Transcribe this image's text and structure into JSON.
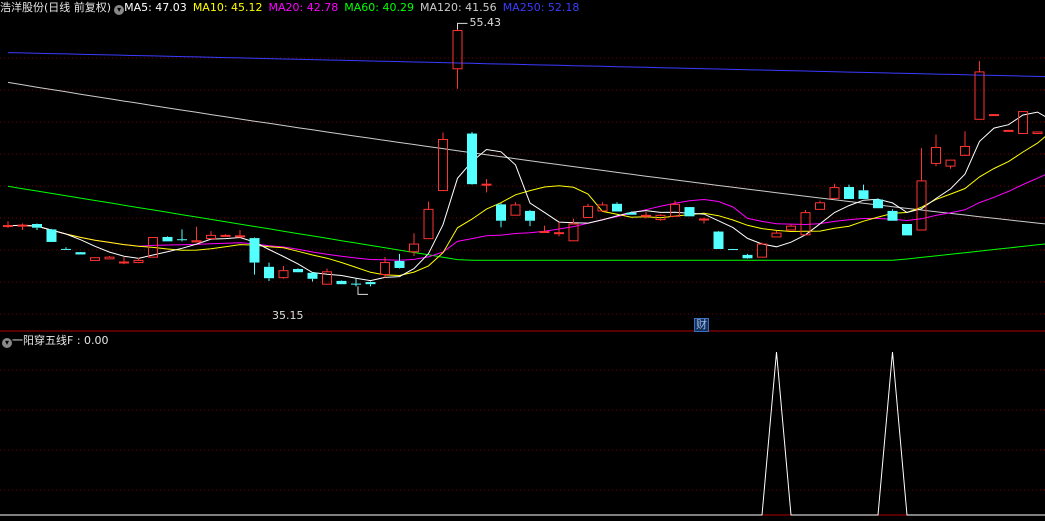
{
  "header": {
    "stock_title": "浩洋股份(日线 前复权)",
    "indicators": [
      {
        "label": "MA5: 47.03",
        "color": "#ffffff"
      },
      {
        "label": "MA10: 45.12",
        "color": "#ffff00"
      },
      {
        "label": "MA20: 42.78",
        "color": "#ff00ff"
      },
      {
        "label": "MA60: 40.29",
        "color": "#00ff00"
      },
      {
        "label": "MA120: 41.56",
        "color": "#cccccc"
      },
      {
        "label": "MA250: 52.18",
        "color": "#3b3bff"
      }
    ]
  },
  "annotations": {
    "high_label": "55.43",
    "low_label": "35.15",
    "event_marker": "财"
  },
  "lower_panel": {
    "title": "一阳穿五线F : 0.00"
  },
  "colors": {
    "up_candle": "#ff3232",
    "down_candle": "#54ffff",
    "grid": "#7a0000",
    "panel_border": "#b00000"
  },
  "chart_data": [
    {
      "type": "candlestick",
      "name": "price",
      "ylim": [
        34.3,
        56.3
      ],
      "candles": [
        [
          41.61,
          41.64,
          41.94,
          41.48
        ],
        [
          41.64,
          41.67,
          41.79,
          41.33
        ],
        [
          41.75,
          41.49,
          41.79,
          41.33
        ],
        [
          41.37,
          40.49,
          41.41,
          40.49
        ],
        [
          40.0,
          39.96,
          40.12,
          39.96
        ],
        [
          39.77,
          39.61,
          39.73,
          39.61
        ],
        [
          39.19,
          39.38,
          39.42,
          39.15
        ],
        [
          39.3,
          39.42,
          39.5,
          39.27
        ],
        [
          39.08,
          39.08,
          39.46,
          38.93
        ],
        [
          39.04,
          39.19,
          39.38,
          39.0
        ],
        [
          39.42,
          40.8,
          40.8,
          39.42
        ],
        [
          40.84,
          40.53,
          40.88,
          40.53
        ],
        [
          40.68,
          40.61,
          41.37,
          40.53
        ],
        [
          40.49,
          40.57,
          41.56,
          40.53
        ],
        [
          40.72,
          40.95,
          41.25,
          40.72
        ],
        [
          40.88,
          40.95,
          41.03,
          40.84
        ],
        [
          40.88,
          40.92,
          41.33,
          40.8
        ],
        [
          40.76,
          39.04,
          40.8,
          38.2
        ],
        [
          38.74,
          37.94,
          39.04,
          37.74
        ],
        [
          37.98,
          38.47,
          38.81,
          37.9
        ],
        [
          38.59,
          38.36,
          38.63,
          38.36
        ],
        [
          38.32,
          37.9,
          38.36,
          37.71
        ],
        [
          37.52,
          38.39,
          38.62,
          37.52
        ],
        [
          37.75,
          37.52,
          37.79,
          37.52
        ],
        [
          37.56,
          37.52,
          37.9,
          37.37
        ],
        [
          37.67,
          37.52,
          37.71,
          37.37
        ],
        [
          38.2,
          39.04,
          39.42,
          37.98
        ],
        [
          39.15,
          38.66,
          39.65,
          38.62
        ],
        [
          39.8,
          40.34,
          41.1,
          39.5
        ],
        [
          40.72,
          42.78,
          43.32,
          40.72
        ],
        [
          44.1,
          47.69,
          48.18,
          44.1
        ],
        [
          52.66,
          55.35,
          55.43,
          51.25
        ],
        [
          48.11,
          44.55,
          48.22,
          44.52
        ],
        [
          44.55,
          44.55,
          44.91,
          43.97
        ],
        [
          43.13,
          41.98,
          43.21,
          41.52
        ],
        [
          42.37,
          43.09,
          43.28,
          42.37
        ],
        [
          42.67,
          41.98,
          42.74,
          41.6
        ],
        [
          41.22,
          41.22,
          41.64,
          41.22
        ],
        [
          41.11,
          41.14,
          41.87,
          40.88
        ],
        [
          40.57,
          41.75,
          42.13,
          40.57
        ],
        [
          42.21,
          42.99,
          43.17,
          42.21
        ],
        [
          42.67,
          43.09,
          43.28,
          42.67
        ],
        [
          43.17,
          42.63,
          43.28,
          42.63
        ],
        [
          42.55,
          42.4,
          42.63,
          42.4
        ],
        [
          42.36,
          42.36,
          42.59,
          42.13
        ],
        [
          42.06,
          42.36,
          42.44,
          41.98
        ],
        [
          42.29,
          43.13,
          43.39,
          42.29
        ],
        [
          42.94,
          42.29,
          42.86,
          42.29
        ],
        [
          42.1,
          42.1,
          42.21,
          41.79
        ],
        [
          41.22,
          39.99,
          41.25,
          39.99
        ],
        [
          39.99,
          39.96,
          40.0,
          39.96
        ],
        [
          39.58,
          39.34,
          39.65,
          39.31
        ],
        [
          39.42,
          40.34,
          40.45,
          39.42
        ],
        [
          40.84,
          41.11,
          41.26,
          40.84
        ],
        [
          41.33,
          41.6,
          41.71,
          41.33
        ],
        [
          40.99,
          42.55,
          42.74,
          40.99
        ],
        [
          42.78,
          43.24,
          43.39,
          42.78
        ],
        [
          43.55,
          44.31,
          44.58,
          43.55
        ],
        [
          44.35,
          43.51,
          44.52,
          43.51
        ],
        [
          44.12,
          43.51,
          44.52,
          43.51
        ],
        [
          43.47,
          42.86,
          43.55,
          42.86
        ],
        [
          42.67,
          41.98,
          42.78,
          41.98
        ],
        [
          41.75,
          40.95,
          41.75,
          40.95
        ],
        [
          41.33,
          44.78,
          47.08,
          41.33
        ],
        [
          46.01,
          47.13,
          48.03,
          45.82
        ],
        [
          45.82,
          46.24,
          46.24,
          45.63
        ],
        [
          46.58,
          47.2,
          48.26,
          46.54
        ],
        [
          49.11,
          52.44,
          53.2,
          49.11
        ],
        [
          49.44,
          49.44,
          49.44,
          49.44
        ],
        [
          48.33,
          48.33,
          48.33,
          48.33
        ],
        [
          48.11,
          49.65,
          49.65,
          48.11
        ],
        [
          48.11,
          48.22,
          48.22,
          48.11
        ],
        [
          49.48,
          49.48,
          49.48,
          49.48
        ]
      ]
    },
    {
      "type": "line",
      "name": "一阳穿五线F",
      "values_nonzero": [
        [
          53,
          1
        ],
        [
          61,
          1
        ]
      ],
      "ylim": [
        0,
        1
      ]
    }
  ]
}
